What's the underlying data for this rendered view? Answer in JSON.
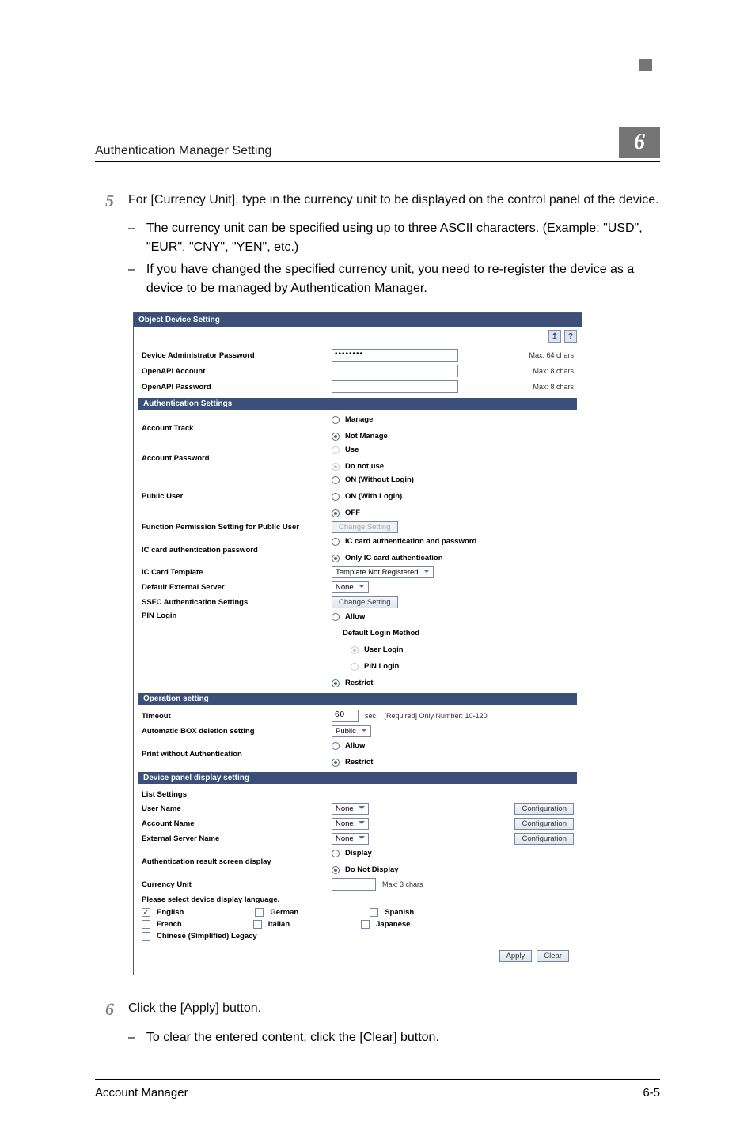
{
  "running_head": {
    "title": "Authentication Manager Setting",
    "chapter": "6"
  },
  "step5": {
    "num": "5",
    "text": "For [Currency Unit], type in the currency unit to be displayed on the control panel of the device.",
    "bullets": [
      "The currency unit can be specified using up to three ASCII characters. (Example: \"USD\", \"EUR\", \"CNY\", \"YEN\", etc.)",
      "If you have changed the specified currency unit, you need to re-register the device as a device to be managed by Authentication Manager."
    ]
  },
  "shot": {
    "title": "Object Device Setting",
    "top_icons": [
      "↥",
      "?"
    ],
    "creds": {
      "admin_pw_label": "Device Administrator Password",
      "admin_pw_value": "••••••••",
      "admin_pw_hint": "Max: 64 chars",
      "openapi_acc_label": "OpenAPI Account",
      "openapi_acc_hint": "Max: 8 chars",
      "openapi_pw_label": "OpenAPI Password",
      "openapi_pw_hint": "Max: 8 chars"
    },
    "auth": {
      "section": "Authentication Settings",
      "account_track_label": "Account Track",
      "account_track_opts": [
        "Manage",
        "Not Manage"
      ],
      "account_pw_label": "Account Password",
      "account_pw_opts": [
        "Use",
        "Do not use"
      ],
      "public_user_label": "Public User",
      "public_user_opts": [
        "ON (Without Login)",
        "ON (With Login)",
        "OFF"
      ],
      "func_perm_label": "Function Permission Setting for Public User",
      "func_perm_btn": "Change Setting",
      "ic_pw_label": "IC card authentication password",
      "ic_pw_opts": [
        "IC card authentication and password",
        "Only IC card authentication"
      ],
      "ic_tpl_label": "IC Card Template",
      "ic_tpl_value": "Template Not Registered",
      "def_ext_label": "Default External Server",
      "def_ext_value": "None",
      "ssfc_label": "SSFC Authentication Settings",
      "ssfc_btn": "Change Setting",
      "pin_label": "PIN Login",
      "pin_allow": "Allow",
      "pin_method": "Default Login Method",
      "pin_sub": [
        "User Login",
        "PIN Login"
      ],
      "pin_restrict": "Restrict"
    },
    "op": {
      "section": "Operation setting",
      "timeout_label": "Timeout",
      "timeout_value": "60",
      "timeout_unit": "sec.",
      "timeout_hint": "[Required] Only Number: 10-120",
      "autobox_label": "Automatic BOX deletion setting",
      "autobox_value": "Public",
      "print_noauth_label": "Print without Authentication",
      "print_noauth_opts": [
        "Allow",
        "Restrict"
      ]
    },
    "disp": {
      "section": "Device panel display setting",
      "list_label": "List Settings",
      "user_name_label": "User Name",
      "user_name_value": "None",
      "account_name_label": "Account Name",
      "account_name_value": "None",
      "ext_srv_label": "External Server Name",
      "ext_srv_value": "None",
      "config_btn": "Configuration",
      "auth_res_label": "Authentication result screen display",
      "auth_res_opts": [
        "Display",
        "Do Not Display"
      ],
      "currency_label": "Currency Unit",
      "currency_hint": "Max: 3 chars",
      "lang_prompt": "Please select device display language.",
      "langs_row1": [
        "English",
        "German",
        "Spanish"
      ],
      "langs_row2": [
        "French",
        "Italian",
        "Japanese"
      ],
      "langs_row3": [
        "Chinese (Simplified) Legacy"
      ],
      "english_checked": "✓"
    },
    "buttons": {
      "apply": "Apply",
      "clear": "Clear"
    }
  },
  "step6": {
    "num": "6",
    "text": "Click the [Apply] button.",
    "bullets": [
      "To clear the entered content, click the [Clear] button."
    ]
  },
  "footer": {
    "product": "Account Manager",
    "page": "6-5"
  }
}
